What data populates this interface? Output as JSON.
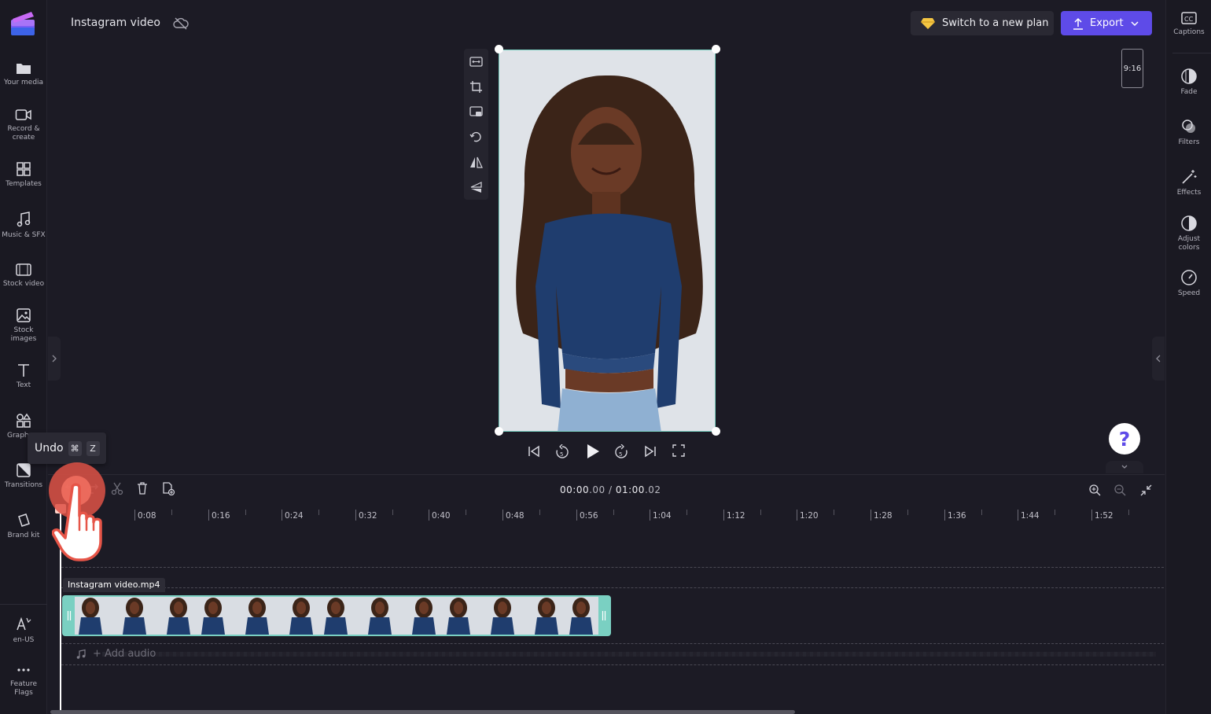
{
  "header": {
    "project_title": "Instagram video",
    "plan_button": "Switch to a new plan",
    "export_button": "Export"
  },
  "left_nav": [
    {
      "id": "your-media",
      "label": "Your media"
    },
    {
      "id": "record-create",
      "label": "Record &",
      "label2": "create"
    },
    {
      "id": "templates",
      "label": "Templates"
    },
    {
      "id": "music-sfx",
      "label": "Music & SFX"
    },
    {
      "id": "stock-video",
      "label": "Stock video"
    },
    {
      "id": "stock-images",
      "label": "Stock",
      "label2": "images"
    },
    {
      "id": "text",
      "label": "Text"
    },
    {
      "id": "graphics",
      "label": "Graph"
    },
    {
      "id": "transitions",
      "label": "Transitions"
    },
    {
      "id": "brand-kit",
      "label": "Brand kit"
    },
    {
      "id": "language",
      "label": "en-US"
    },
    {
      "id": "feature-flags",
      "label": "Feature",
      "label2": "Flags"
    }
  ],
  "right_nav": [
    {
      "id": "captions",
      "label": "Captions"
    },
    {
      "id": "fade",
      "label": "Fade"
    },
    {
      "id": "filters",
      "label": "Filters"
    },
    {
      "id": "effects",
      "label": "Effects"
    },
    {
      "id": "adjust-colors",
      "label": "Adjust",
      "label2": "colors"
    },
    {
      "id": "speed",
      "label": "Speed"
    }
  ],
  "preview": {
    "aspect_ratio": "9:16"
  },
  "timeline": {
    "current_time_main": "00:00",
    "current_time_frac": ".00",
    "separator": " / ",
    "total_time_main": "01:00",
    "total_time_frac": ".02",
    "ruler_labels": [
      "0:08",
      "0:16",
      "0:24",
      "0:32",
      "0:40",
      "0:48",
      "0:56",
      "1:04",
      "1:12",
      "1:20",
      "1:28",
      "1:36",
      "1:44",
      "1:52"
    ],
    "clip_name": "Instagram video.mp4",
    "add_audio": "+ Add audio"
  },
  "tooltip": {
    "label": "Undo",
    "key1": "⌘",
    "key2": "Z"
  },
  "colors": {
    "accent": "#5e4be8",
    "clip_border": "#7ad0c2",
    "background": "#1c1b25"
  }
}
